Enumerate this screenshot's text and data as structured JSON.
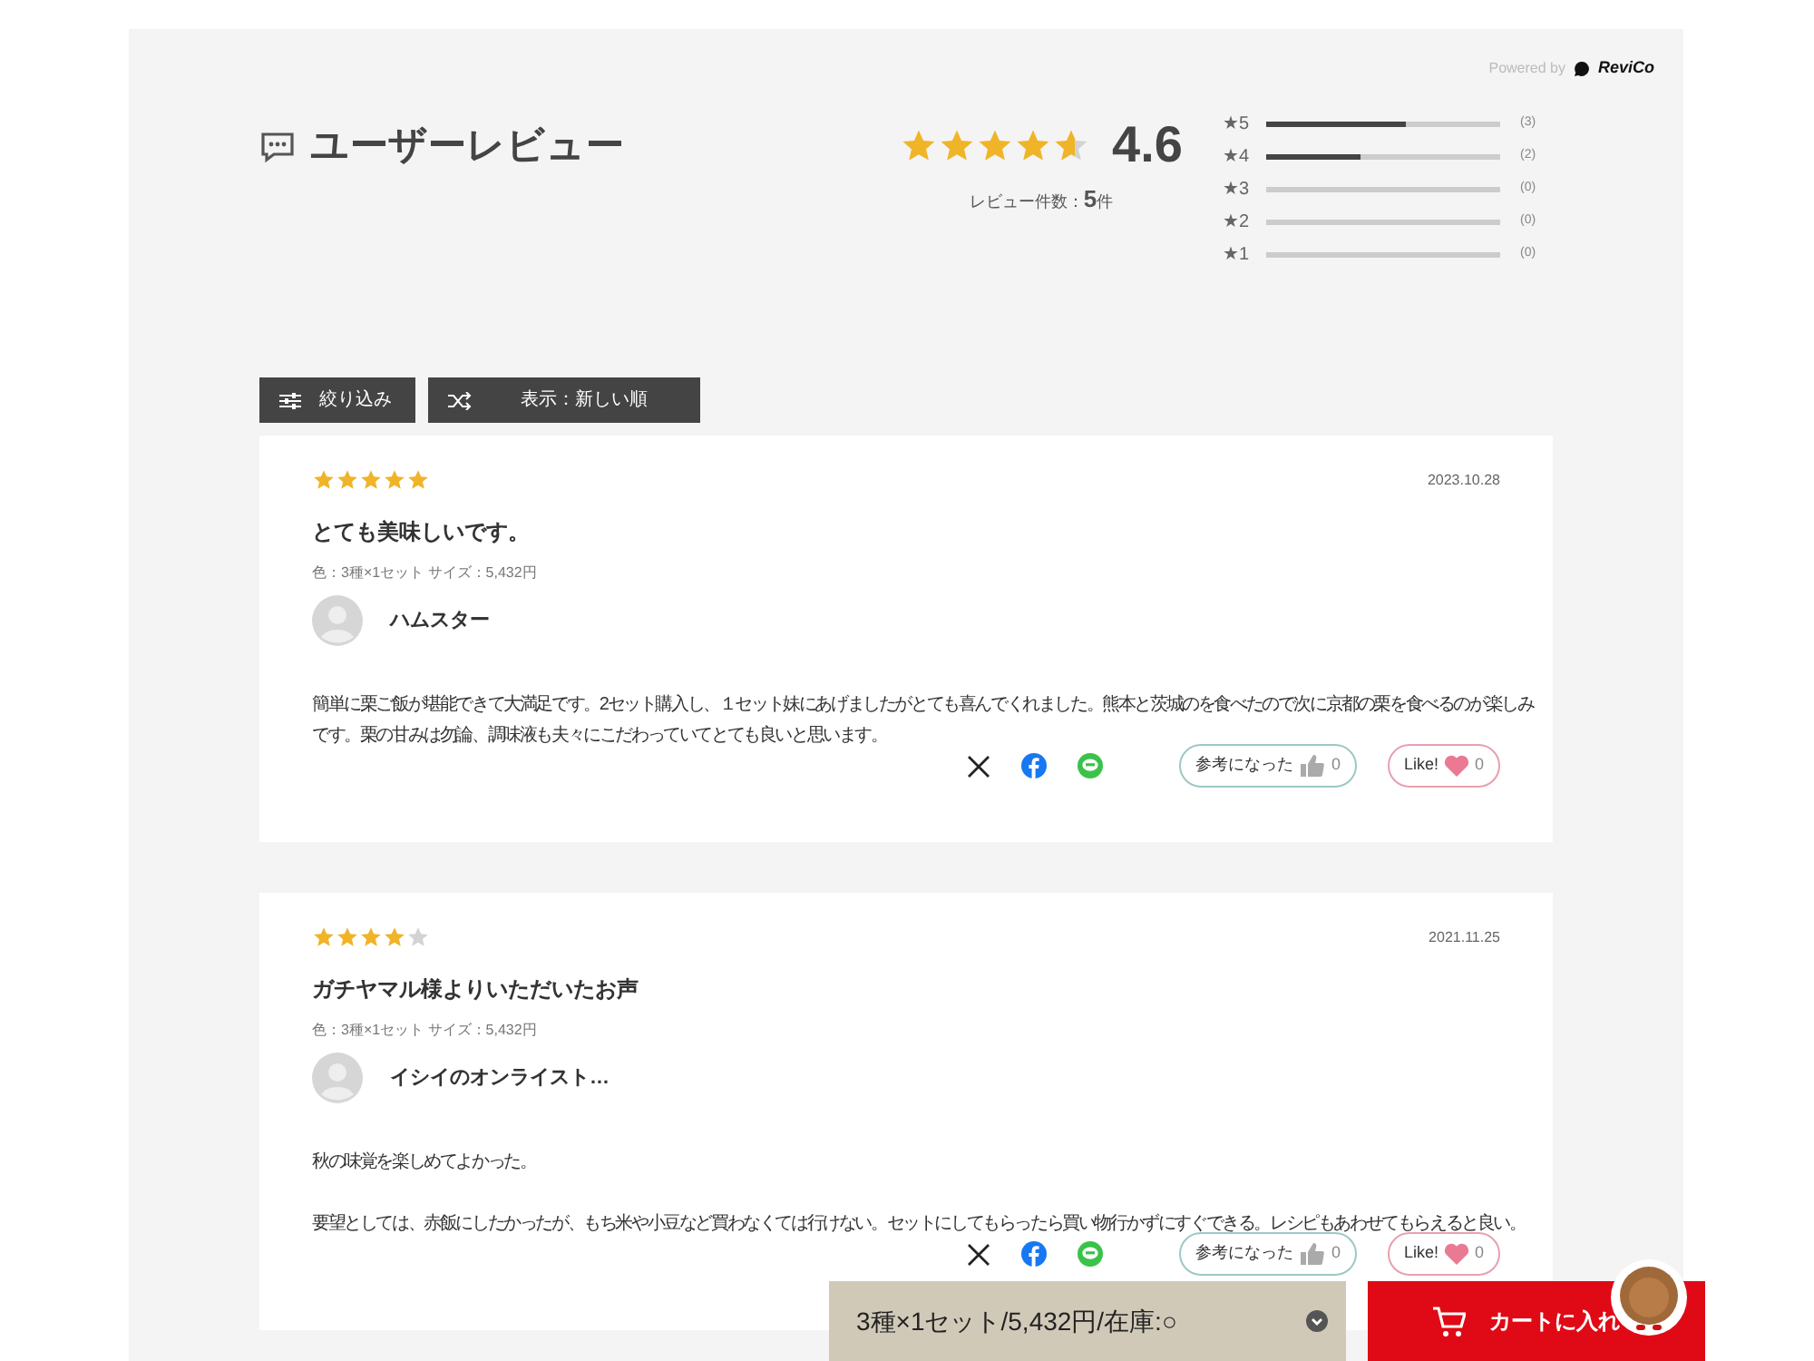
{
  "powered_by": {
    "label": "Powered by",
    "brand": "ReviCo"
  },
  "header": {
    "title": "ユーザーレビュー",
    "stars": 4.6,
    "score": "4.6",
    "count_label": "レビュー件数：",
    "count": "5",
    "count_unit": "件"
  },
  "distribution": [
    {
      "label": "★5",
      "level": 0.6,
      "count": "(3)"
    },
    {
      "label": "★4",
      "level": 0.4,
      "count": "(2)"
    },
    {
      "label": "★3",
      "level": 0,
      "count": "(0)"
    },
    {
      "label": "★2",
      "level": 0,
      "count": "(0)"
    },
    {
      "label": "★1",
      "level": 0,
      "count": "(0)"
    }
  ],
  "toolbar": {
    "filter": "絞り込み",
    "sort": "表示：新しい順"
  },
  "reviews": [
    {
      "stars": 5,
      "date": "2023.10.28",
      "title": "とても美味しいです。",
      "variant": "色：3種×1セット サイズ：5,432円",
      "author": "ハムスター",
      "paragraphs": [
        "簡単に栗ご飯が堪能できて大満足です。2セット購入し、１セット妹にあげましたがとても喜んでくれました。熊本と茨城のを食べたので次に京都の栗を食べるのが楽しみです。栗の甘みは勿論、調味液も夫々にこだわっていてとても良いと思います。"
      ],
      "helpful_label": "参考になった",
      "helpful_count": "0",
      "like_label": "Like!",
      "like_count": "0"
    },
    {
      "stars": 4,
      "date": "2021.11.25",
      "title": "ガチヤマル様よりいただいたお声",
      "variant": "色：3種×1セット サイズ：5,432円",
      "author": "イシイのオンライスト…",
      "paragraphs": [
        "秋の味覚を楽しめてよかった。",
        "要望としては、赤飯にしたかったが、もち米や小豆など買わなくては行けない。セットにしてもらったら買い物行かずにすぐできる。レシピもあわせてもらえると良い。"
      ],
      "helpful_label": "参考になった",
      "helpful_count": "0",
      "like_label": "Like!",
      "like_count": "0"
    }
  ],
  "purchase_bar": {
    "option": "3種×1セット/5,432円/在庫:○",
    "cart_button": "カートに入れ"
  }
}
